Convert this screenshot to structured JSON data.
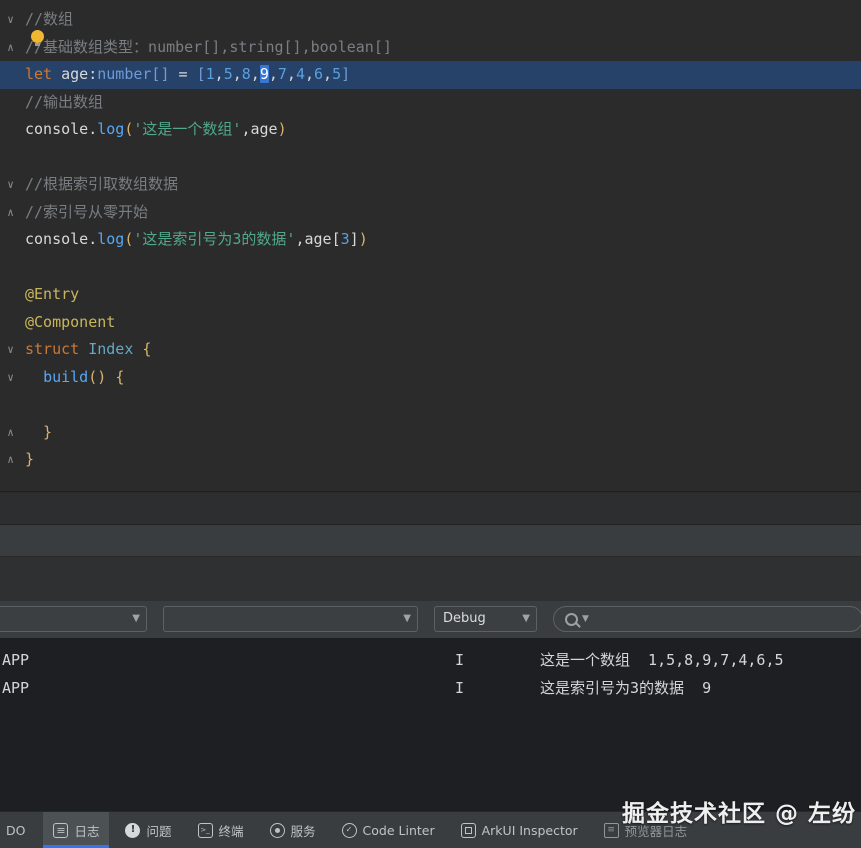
{
  "colors": {
    "accent_blue": "#3574f0",
    "selected_line_bg": "#264269",
    "caret_selection_bg": "#3677d6",
    "editor_bg": "#2b2b2b",
    "console_bg": "#1e1f22"
  },
  "editor": {
    "bulb_icon": "intention-bulb",
    "lines": [
      {
        "fold": "start",
        "tokens": [
          {
            "t": "//数组",
            "c": "com"
          }
        ]
      },
      {
        "fold": "end",
        "tokens": [
          {
            "t": "//基础数组类型：number[],string[],boolean[]",
            "c": "com"
          }
        ]
      },
      {
        "selected": true,
        "tokens": [
          {
            "t": "let",
            "c": "kw"
          },
          {
            "t": " age:",
            "c": "pl"
          },
          {
            "t": "number[]",
            "c": "type"
          },
          {
            "t": " = ",
            "c": "pl"
          },
          {
            "t": "[",
            "c": "type"
          },
          {
            "t": "1",
            "c": "num"
          },
          {
            "t": ",",
            "c": "pl"
          },
          {
            "t": "5",
            "c": "num"
          },
          {
            "t": ",",
            "c": "pl"
          },
          {
            "t": "8",
            "c": "num"
          },
          {
            "t": ",",
            "c": "pl"
          },
          {
            "t": "9",
            "c": "num",
            "hl": true
          },
          {
            "t": ",",
            "c": "pl"
          },
          {
            "t": "7",
            "c": "num"
          },
          {
            "t": ",",
            "c": "pl"
          },
          {
            "t": "4",
            "c": "num"
          },
          {
            "t": ",",
            "c": "pl"
          },
          {
            "t": "6",
            "c": "num"
          },
          {
            "t": ",",
            "c": "pl"
          },
          {
            "t": "5",
            "c": "num"
          },
          {
            "t": "]",
            "c": "type"
          }
        ]
      },
      {
        "tokens": [
          {
            "t": "//输出数组",
            "c": "com"
          }
        ]
      },
      {
        "tokens": [
          {
            "t": "console",
            "c": "pl"
          },
          {
            "t": ".",
            "c": "pl"
          },
          {
            "t": "log",
            "c": "fn"
          },
          {
            "t": "(",
            "c": "br"
          },
          {
            "t": "'这是一个数组'",
            "c": "str"
          },
          {
            "t": ",",
            "c": "pl"
          },
          {
            "t": "age",
            "c": "pl"
          },
          {
            "t": ")",
            "c": "br"
          }
        ]
      },
      {
        "tokens": []
      },
      {
        "fold": "start",
        "tokens": [
          {
            "t": "//根据索引取数组数据",
            "c": "com"
          }
        ]
      },
      {
        "fold": "end",
        "tokens": [
          {
            "t": "//索引号从零开始",
            "c": "com"
          }
        ]
      },
      {
        "tokens": [
          {
            "t": "console",
            "c": "pl"
          },
          {
            "t": ".",
            "c": "pl"
          },
          {
            "t": "log",
            "c": "fn"
          },
          {
            "t": "(",
            "c": "br"
          },
          {
            "t": "'这是索引号为3的数据'",
            "c": "str"
          },
          {
            "t": ",",
            "c": "pl"
          },
          {
            "t": "age",
            "c": "pl"
          },
          {
            "t": "[",
            "c": "pl"
          },
          {
            "t": "3",
            "c": "num"
          },
          {
            "t": "]",
            "c": "pl"
          },
          {
            "t": ")",
            "c": "br"
          }
        ]
      },
      {
        "tokens": []
      },
      {
        "tokens": [
          {
            "t": "@Entry",
            "c": "ann"
          }
        ]
      },
      {
        "tokens": [
          {
            "t": "@Component",
            "c": "ann"
          }
        ]
      },
      {
        "fold": "start",
        "tokens": [
          {
            "t": "struct ",
            "c": "kw"
          },
          {
            "t": "Index ",
            "c": "cls"
          },
          {
            "t": "{",
            "c": "br"
          }
        ]
      },
      {
        "fold": "start",
        "tokens": [
          {
            "t": "  ",
            "c": "pl"
          },
          {
            "t": "build",
            "c": "fn"
          },
          {
            "t": "()",
            "c": "br"
          },
          {
            "t": " ",
            "c": "pl"
          },
          {
            "t": "{",
            "c": "br"
          }
        ]
      },
      {
        "tokens": []
      },
      {
        "fold": "end",
        "tokens": [
          {
            "t": "  }",
            "c": "br"
          }
        ]
      },
      {
        "fold": "end",
        "tokens": [
          {
            "t": "}",
            "c": "br"
          }
        ]
      }
    ]
  },
  "filter_bar": {
    "combo1_value": "",
    "combo2_value": "",
    "debug_combo_value": "Debug",
    "search_value": ""
  },
  "console": {
    "rows": [
      {
        "source": "APP",
        "level": "I",
        "message": "这是一个数组  1,5,8,9,7,4,6,5"
      },
      {
        "source": "APP",
        "level": "I",
        "message": "这是索引号为3的数据  9"
      }
    ]
  },
  "watermark": "掘金技术社区 @ 左纷",
  "bottom_bar": {
    "items": [
      {
        "name": "todo-partial",
        "label": "DO",
        "icon": null,
        "selected": false
      },
      {
        "name": "log",
        "label": "日志",
        "icon": "log-icon",
        "selected": true
      },
      {
        "name": "problems",
        "label": "问题",
        "icon": "problems-icon",
        "selected": false
      },
      {
        "name": "terminal",
        "label": "终端",
        "icon": "terminal-icon",
        "selected": false
      },
      {
        "name": "services",
        "label": "服务",
        "icon": "services-icon",
        "selected": false
      },
      {
        "name": "code-linter",
        "label": "Code Linter",
        "icon": "linter-icon",
        "selected": false
      },
      {
        "name": "arkui-inspector",
        "label": "ArkUI Inspector",
        "icon": "arkui-icon",
        "selected": false
      },
      {
        "name": "previewer-log",
        "label": "预览器日志",
        "icon": "preview-log-icon",
        "selected": false,
        "muted": true
      }
    ]
  }
}
